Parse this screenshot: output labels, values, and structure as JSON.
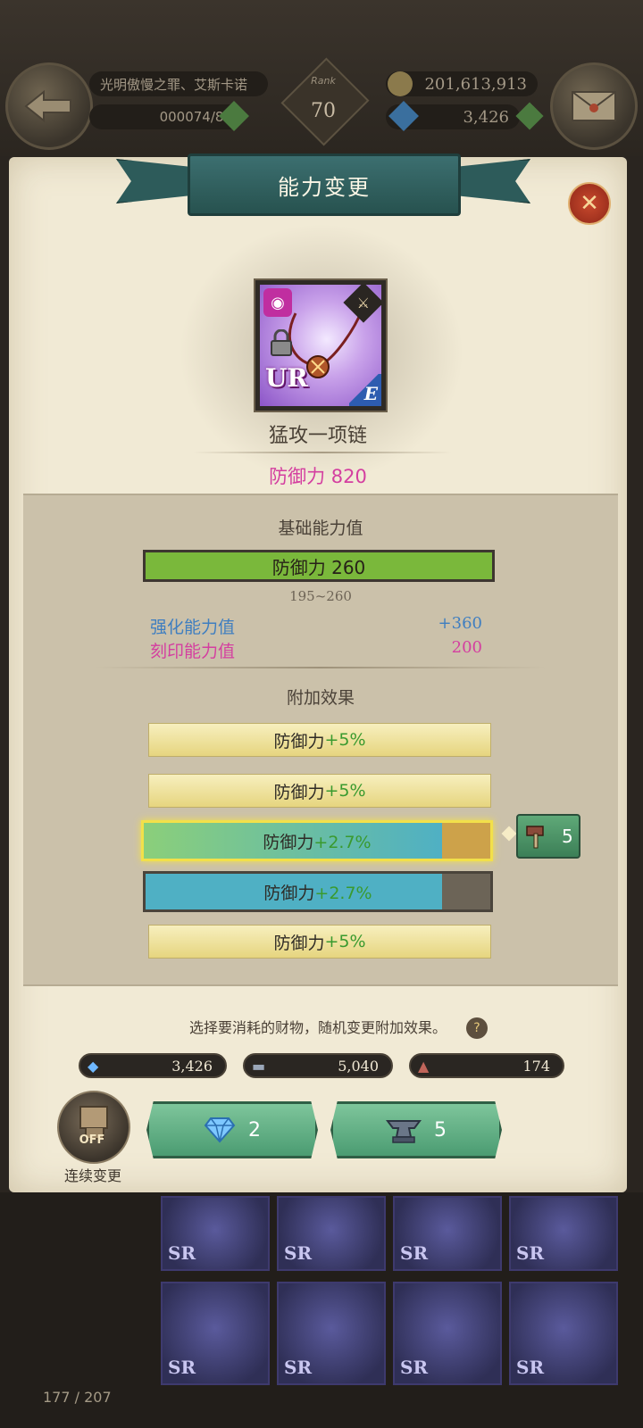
{
  "header": {
    "player_name": "光明傲慢之罪、艾斯卡诺",
    "exp": "000074/89",
    "rank_label": "Rank",
    "rank_value": "70",
    "gold": "201,613,913",
    "gems": "3,426"
  },
  "dialog": {
    "title": "能力变更",
    "item_name": "猛攻一项链",
    "item_grade": "UR",
    "item_type": "E",
    "total_stat": "防御力 820",
    "base_section": "基础能力值",
    "base_stat": "防御力 260",
    "base_range": "195~260",
    "enhance_label": "强化能力值",
    "enhance_value": "+360",
    "engrave_label": "刻印能力值",
    "engrave_value": "200",
    "effects_section": "附加效果",
    "effects": [
      {
        "label": "防御力",
        "value": "+5%"
      },
      {
        "label": "防御力",
        "value": "+5%"
      },
      {
        "label": "防御力",
        "value": "+2.7%",
        "fill": 0.86
      },
      {
        "label": "防御力",
        "value": "+2.7%",
        "fill": 0.86
      },
      {
        "label": "防御力",
        "value": "+5%"
      }
    ],
    "hammer_cost": "5",
    "hint": "选择要消耗的财物，随机变更附加效果。",
    "currencies": [
      {
        "icon": "diamond-icon",
        "value": "3,426"
      },
      {
        "icon": "anvil-icon",
        "value": "5,040"
      },
      {
        "icon": "hammer-icon",
        "value": "174"
      }
    ],
    "auto_state": "OFF",
    "auto_label": "连续变更",
    "btn_diamond_cost": "2",
    "btn_anvil_cost": "5"
  },
  "inventory": {
    "count": "177 / 207",
    "slot_grade": "SR"
  },
  "colors": {
    "accent_pink": "#d43fa0",
    "accent_blue": "#3f7ec0",
    "bar_green": "#7ab83b",
    "bar_teal": "#4fb0c4",
    "effect_plus": "#3a9a2f"
  }
}
